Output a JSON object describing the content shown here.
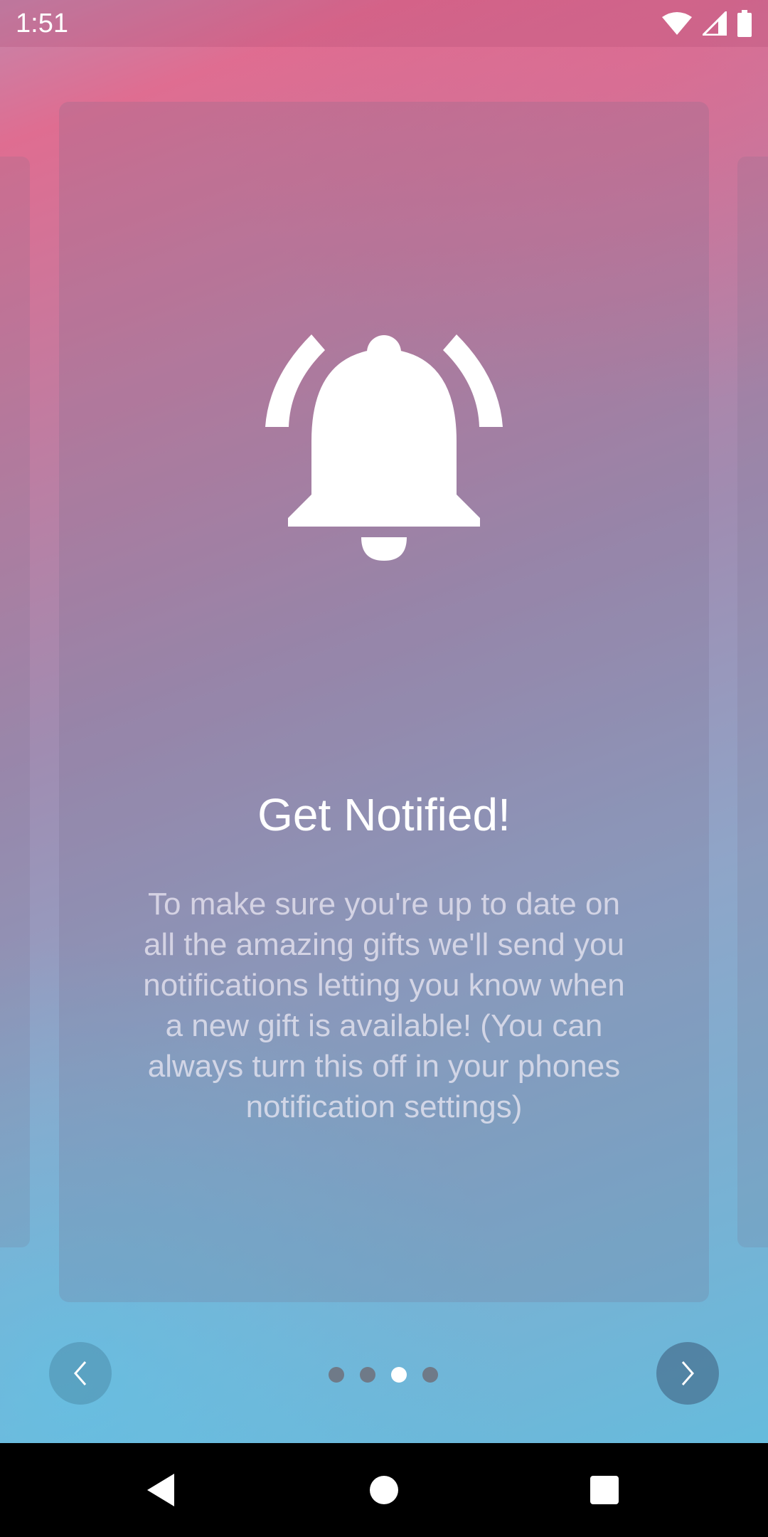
{
  "status_bar": {
    "time": "1:51",
    "icons": [
      "wifi-icon",
      "cellular-signal-icon",
      "battery-icon"
    ]
  },
  "slide": {
    "icon": "bell-ringing-icon",
    "title": "Get Notified!",
    "description": "To make sure you're up to date on all the amazing gifts we'll send you notifications letting you know when a new gift is available! (You can always turn this off in your phones notification settings)"
  },
  "pager": {
    "total_pages": 4,
    "current_page": 3
  },
  "controls": {
    "previous_icon": "chevron-left-icon",
    "next_icon": "chevron-right-icon"
  },
  "system_nav": {
    "icons": [
      "back-icon",
      "home-icon",
      "recents-icon"
    ]
  },
  "colors": {
    "gradient_top": "#df6d91",
    "gradient_middle": "#a08cb1",
    "gradient_bottom": "#5fbfe0",
    "dot_inactive": "#6f7a88",
    "dot_active": "#ffffff"
  }
}
